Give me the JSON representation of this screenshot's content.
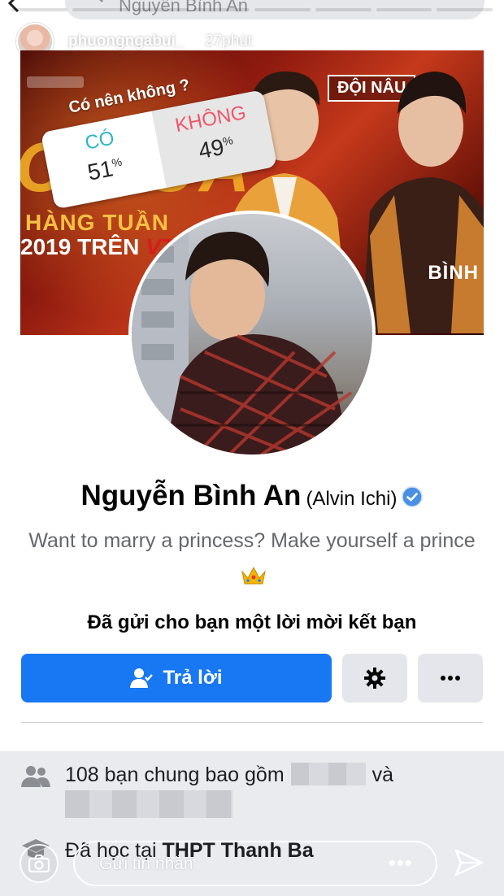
{
  "search": {
    "query": "Nguyễn Bình An"
  },
  "story": {
    "username": "phuongngabui_",
    "time": "27phút",
    "reply_placeholder": "Gửi tin nhắn",
    "more_label": "•••"
  },
  "poll": {
    "question": "Có nên không ?",
    "options": [
      {
        "label": "CÓ",
        "percent": "51",
        "color": "#2bb6c9"
      },
      {
        "label": "KHÔNG",
        "percent": "49",
        "color": "#f0566a"
      }
    ],
    "percent_sign": "%"
  },
  "cover": {
    "line1": "C ĐUA",
    "line2": "HÀNG TUẦN",
    "line3_prefix": "2019 TRÊN ",
    "line3_brand": "VTV",
    "team": "ĐỘI NÂU",
    "corner_name": "BÌNH"
  },
  "profile": {
    "name": "Nguyễn Bình An",
    "alt_name": "(Alvin Ichi)",
    "bio": "Want to marry a princess? Make yourself a prince",
    "request_text": "Đã gửi cho bạn một lời mời kết bạn",
    "reply_button": "Trả lời",
    "mutual_prefix": "108 bạn chung bao gồm",
    "mutual_and": "và",
    "school_prefix": "Đã học tại ",
    "school_name": "THPT Thanh Ba"
  },
  "colors": {
    "primary": "#1877f2",
    "secondary_button": "#e4e6eb",
    "verified": "#4a90e2"
  },
  "icons": [
    "back-arrow-icon",
    "search-icon",
    "close-icon",
    "verified-badge-icon",
    "crown-icon",
    "add-friend-icon",
    "gear-icon",
    "more-icon",
    "friends-icon",
    "graduation-cap-icon",
    "camera-icon",
    "send-icon"
  ]
}
